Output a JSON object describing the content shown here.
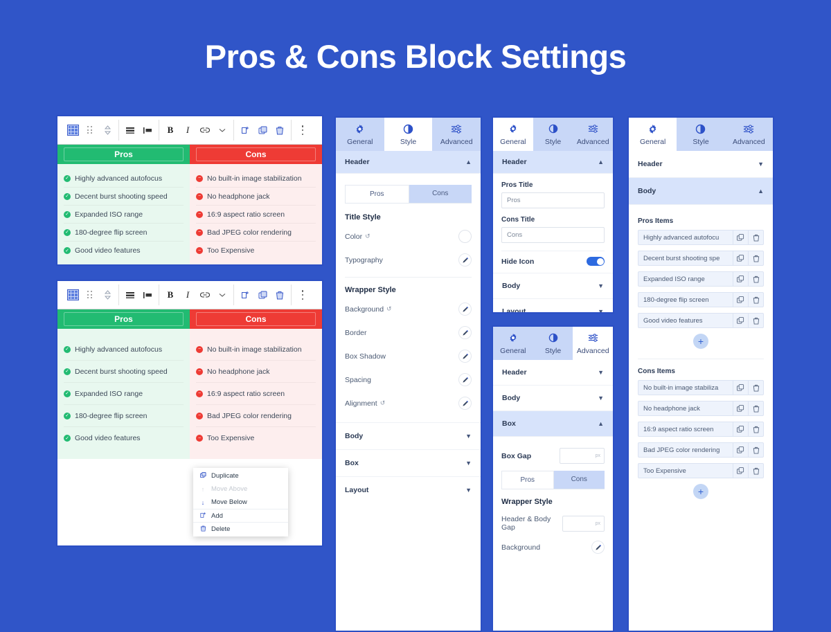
{
  "page": {
    "title": "Pros & Cons Block Settings",
    "background_color": "#3055c8"
  },
  "colors": {
    "accent": "#2d6ae0",
    "pros_green": "#22bb72",
    "cons_red": "#ee3b35",
    "tab_inactive": "#c8d7f7"
  },
  "toolbar": {
    "icons": [
      {
        "name": "table-grid-icon",
        "glyph": "grid"
      },
      {
        "name": "drag-handle-icon",
        "glyph": "dots6"
      },
      {
        "name": "move-updown-icon",
        "glyph": "updown"
      },
      {
        "name": "align-center-icon",
        "glyph": "align"
      },
      {
        "name": "align-left-icon",
        "glyph": "alignleft"
      },
      {
        "name": "bold-icon",
        "glyph": "B"
      },
      {
        "name": "italic-icon",
        "glyph": "I"
      },
      {
        "name": "link-icon",
        "glyph": "link"
      },
      {
        "name": "chevron-down-icon",
        "glyph": "chevron"
      },
      {
        "name": "add-icon",
        "glyph": "add"
      },
      {
        "name": "duplicate-icon",
        "glyph": "copy"
      },
      {
        "name": "delete-icon",
        "glyph": "trash"
      },
      {
        "name": "more-options-icon",
        "glyph": "dots3v"
      }
    ]
  },
  "block_preview": {
    "pros_header": "Pros",
    "cons_header": "Cons",
    "pros_items": [
      "Highly advanced autofocus",
      "Decent burst shooting speed",
      "Expanded ISO range",
      "180-degree flip screen",
      "Good video features"
    ],
    "cons_items": [
      "No built-in image stabilization",
      "No headphone jack",
      "16:9 aspect ratio screen",
      "Bad JPEG color rendering",
      "Too Expensive"
    ]
  },
  "context_menu": {
    "items": [
      {
        "label": "Duplicate",
        "icon": "duplicate-icon",
        "disabled": false
      },
      {
        "label": "Move Above",
        "icon": "arrow-up-icon",
        "disabled": true
      },
      {
        "label": "Move Below",
        "icon": "arrow-down-icon",
        "disabled": false
      },
      {
        "label": "Add",
        "icon": "add-icon",
        "disabled": false
      },
      {
        "label": "Delete",
        "icon": "trash-icon",
        "disabled": false
      }
    ]
  },
  "tabs": {
    "general": "General",
    "style": "Style",
    "advanced": "Advanced"
  },
  "panel_style": {
    "active_tab": "Style",
    "header_section": "Header",
    "subtabs": {
      "pros": "Pros",
      "cons": "Cons",
      "active": "Pros"
    },
    "title_style_heading": "Title Style",
    "color_label": "Color",
    "typography_label": "Typography",
    "wrapper_style_heading": "Wrapper Style",
    "background_label": "Background",
    "border_label": "Border",
    "box_shadow_label": "Box Shadow",
    "spacing_label": "Spacing",
    "alignment_label": "Alignment",
    "body_section": "Body",
    "box_section": "Box",
    "layout_section": "Layout"
  },
  "panel_general": {
    "active_tab": "General",
    "header_section": "Header",
    "pros_title_label": "Pros Title",
    "pros_title_value": "Pros",
    "cons_title_label": "Cons Title",
    "cons_title_value": "Cons",
    "hide_icon_label": "Hide Icon",
    "hide_icon_on": true,
    "body_section": "Body",
    "layout_section": "Layout"
  },
  "panel_advanced": {
    "active_tab": "Advanced",
    "header_section": "Header",
    "body_section": "Body",
    "box_section": "Box",
    "box_gap_label": "Box Gap",
    "box_gap_value": "",
    "box_gap_unit": "px",
    "subtabs": {
      "pros": "Pros",
      "cons": "Cons",
      "active": "Pros"
    },
    "wrapper_style_heading": "Wrapper Style",
    "header_body_gap_label": "Header & Body Gap",
    "header_body_gap_value": "",
    "header_body_gap_unit": "px",
    "background_label": "Background"
  },
  "panel_body": {
    "active_tab": "General",
    "header_section": "Header",
    "body_section": "Body",
    "pros_items_label": "Pros Items",
    "pros_items": [
      "Highly advanced autofocu",
      "Decent burst shooting spe",
      "Expanded ISO range",
      "180-degree flip screen",
      "Good video features"
    ],
    "cons_items_label": "Cons Items",
    "cons_items": [
      "No built-in image stabiliza",
      "No headphone jack",
      "16:9 aspect ratio screen",
      "Bad JPEG color rendering",
      "Too Expensive"
    ],
    "add_label": "+"
  }
}
